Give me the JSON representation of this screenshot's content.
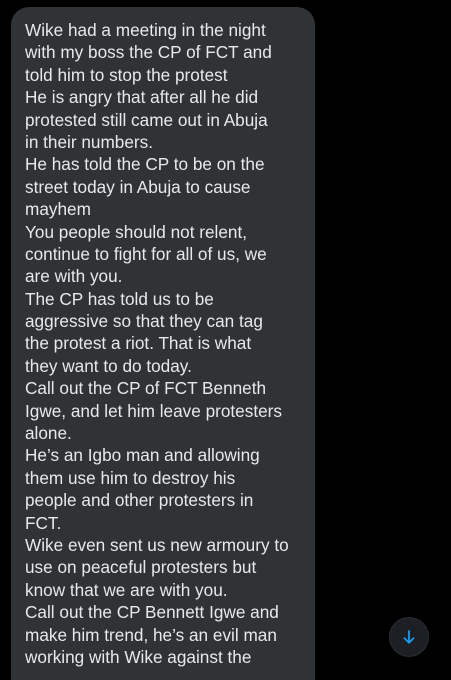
{
  "message": {
    "lines": [
      "Wike had a meeting in the night",
      "with my boss the CP of FCT and",
      "told him to stop the protest",
      "He is angry that after all he did",
      "protested still came out in Abuja",
      "in their numbers.",
      "He has told the CP to be on the",
      "street today in Abuja to cause",
      "mayhem",
      "You people should not relent,",
      "continue to fight for all of us, we",
      "are with you.",
      "The CP has told us to be",
      "aggressive so that they can tag",
      "the protest a riot. That is what",
      "they want to do today.",
      "Call out the CP of FCT Benneth",
      "Igwe, and let him leave protesters",
      "alone.",
      "He’s an Igbo man and allowing",
      "them use him to destroy his",
      "people and other protesters in",
      "FCT.",
      "Wike even sent us new armoury to",
      "use on peaceful protesters but",
      "know that we are with you.",
      "Call out the CP Bennett Igwe and",
      "make him trend, he’s an evil man",
      "working with Wike against the"
    ]
  },
  "scroll_button": {
    "icon": "arrow-down-icon"
  },
  "colors": {
    "background": "#000000",
    "bubble": "#2f3336",
    "text": "#e7e9ea",
    "accent": "#1d9bf0"
  }
}
